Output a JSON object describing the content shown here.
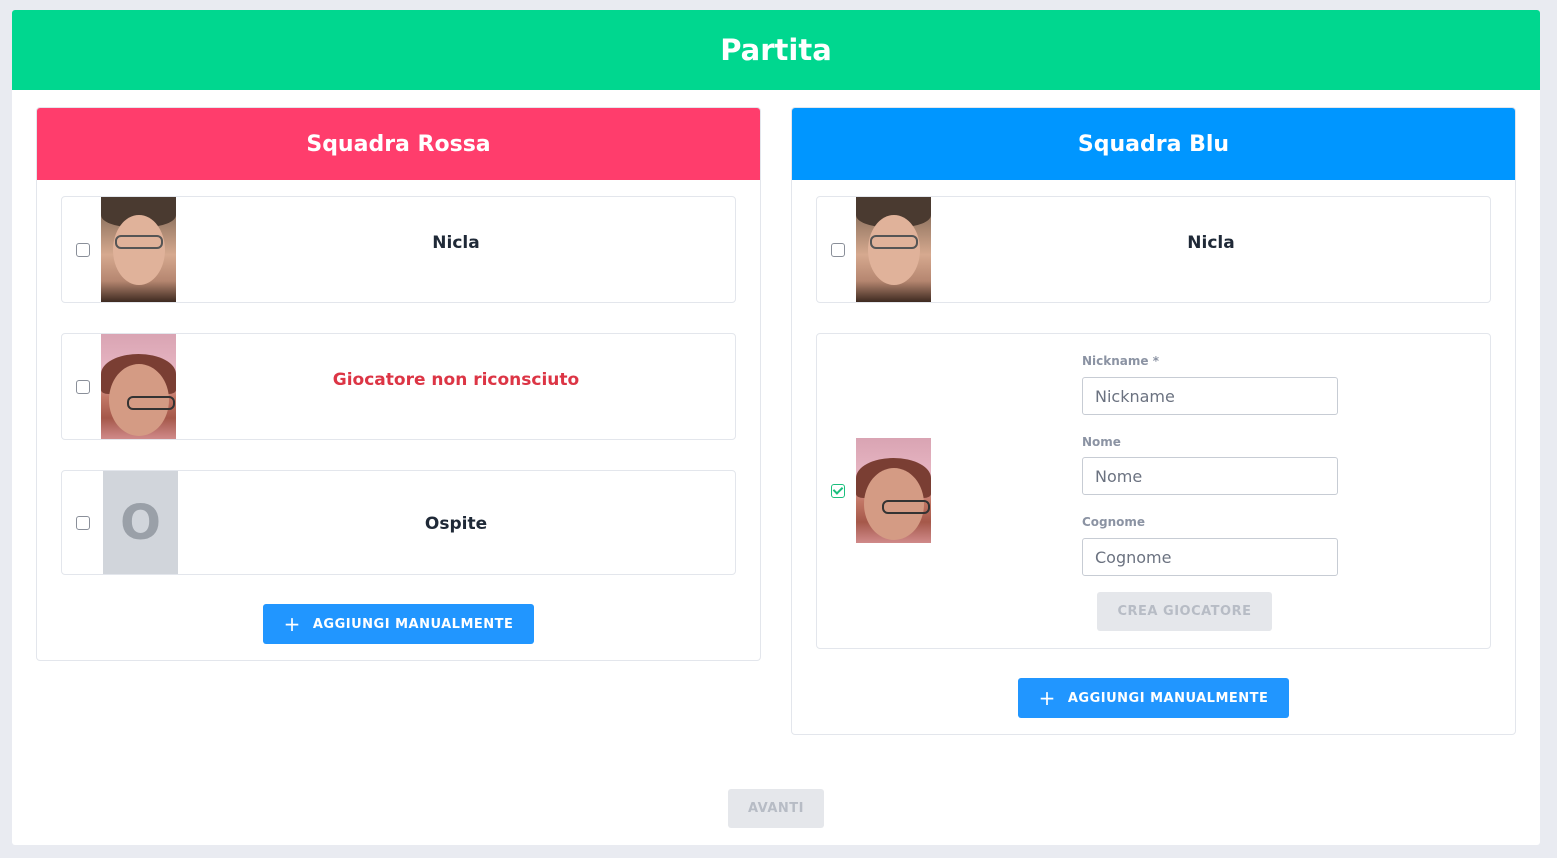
{
  "page": {
    "title": "Partita"
  },
  "red_team": {
    "title": "Squadra Rossa",
    "players": [
      {
        "name": "Nicla",
        "checked": false,
        "avatar": "photo"
      },
      {
        "name": "Giocatore non riconsciuto",
        "checked": false,
        "avatar": "photo",
        "status": "unknown"
      },
      {
        "name": "Ospite",
        "checked": false,
        "avatar": "initial",
        "initial": "O"
      }
    ],
    "add_button": "AGGIUNGI MANUALMENTE"
  },
  "blue_team": {
    "title": "Squadra Blu",
    "players": [
      {
        "name": "Nicla",
        "checked": false,
        "avatar": "photo"
      }
    ],
    "new_player_form": {
      "checked": true,
      "nickname_label": "Nickname *",
      "nickname_placeholder": "Nickname",
      "nome_label": "Nome",
      "nome_placeholder": "Nome",
      "cognome_label": "Cognome",
      "cognome_placeholder": "Cognome",
      "create_button": "CREA GIOCATORE"
    },
    "add_button": "AGGIUNGI MANUALMENTE"
  },
  "footer": {
    "next_button": "AVANTI"
  },
  "colors": {
    "header": "#00d78f",
    "red_team": "#ff3d6c",
    "blue_team": "#0096ff",
    "primary_button": "#2196ff",
    "error_text": "#dc3545"
  }
}
